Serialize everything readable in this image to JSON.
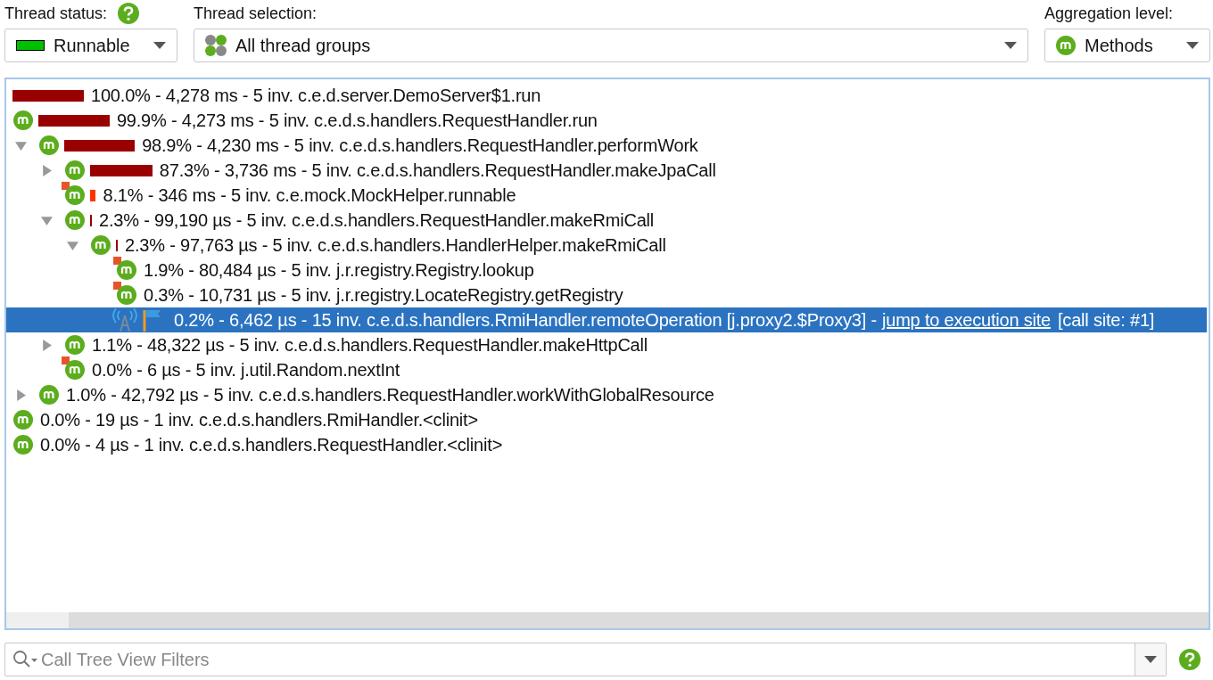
{
  "toolbar": {
    "thread_status": {
      "label": "Thread status:",
      "value": "Runnable"
    },
    "thread_selection": {
      "label": "Thread selection:",
      "value": "All thread groups"
    },
    "aggregation_level": {
      "label": "Aggregation level:",
      "value": "Methods"
    }
  },
  "call_tree": [
    {
      "selected": false,
      "level": 1.0,
      "color": "#990000",
      "text": "100.0% - 4,278 ms - 5 inv. c.e.d.server.DemoServer$1.run",
      "children": [
        {
          "kind": "method",
          "selected": false,
          "level": 0.999,
          "color": "#990000",
          "text": "99.9% - 4,273 ms - 5 inv. c.e.d.s.handlers.RequestHandler.run",
          "children": [
            {
              "kind": "method",
              "selected": false,
              "expanded": true,
              "level": 0.989,
              "color": "#990000",
              "text": "98.9% - 4,230 ms - 5 inv. c.e.d.s.handlers.RequestHandler.performWork",
              "children": [
                {
                  "kind": "method",
                  "selected": false,
                  "expanded": false,
                  "level": 0.873,
                  "color": "#990000",
                  "text": "87.3% - 3,736 ms - 5 inv. c.e.d.s.handlers.RequestHandler.makeJpaCall"
                },
                {
                  "kind": "method-flagged",
                  "selected": false,
                  "level": 0.081,
                  "color": "#ff3300",
                  "text": "8.1% - 346 ms - 5 inv. c.e.mock.MockHelper.runnable"
                },
                {
                  "kind": "method",
                  "selected": false,
                  "expanded": true,
                  "level": 0.023,
                  "color": "#990000",
                  "text": "2.3% - 99,190 µs - 5 inv. c.e.d.s.handlers.RequestHandler.makeRmiCall",
                  "children": [
                    {
                      "kind": "method",
                      "selected": false,
                      "expanded": true,
                      "level": 0.023,
                      "color": "#990000",
                      "text": "2.3% - 97,763 µs - 5 inv. c.e.d.s.handlers.HandlerHelper.makeRmiCall",
                      "children": [
                        {
                          "kind": "method-flagged",
                          "selected": false,
                          "text": "1.9% - 80,484 µs - 5 inv. j.r.registry.Registry.lookup"
                        },
                        {
                          "kind": "method-flagged",
                          "selected": false,
                          "text": "0.3% - 10,731 µs - 5 inv. j.r.registry.LocateRegistry.getRegistry"
                        },
                        {
                          "kind": "rmi",
                          "selected": true,
                          "text": "0.2% - 6,462 µs - 15 inv. c.e.d.s.handlers.RmiHandler.remoteOperation [j.proxy2.$Proxy3] -",
                          "link": "jump to execution site",
                          "call_site": "[call site: #1]"
                        }
                      ]
                    }
                  ]
                },
                {
                  "kind": "method",
                  "selected": false,
                  "expanded": false,
                  "text": "1.1% - 48,322 µs - 5 inv. c.e.d.s.handlers.RequestHandler.makeHttpCall"
                },
                {
                  "kind": "method-flagged",
                  "selected": false,
                  "text": "0.0% - 6 µs - 5 inv. j.util.Random.nextInt"
                }
              ]
            },
            {
              "kind": "method",
              "selected": false,
              "expanded": false,
              "text": "1.0% - 42,792 µs - 5 inv. c.e.d.s.handlers.RequestHandler.workWithGlobalResource"
            }
          ]
        },
        {
          "kind": "method",
          "selected": false,
          "text": "0.0% - 19 µs - 1 inv. c.e.d.s.handlers.RmiHandler.<clinit>"
        },
        {
          "kind": "method",
          "selected": false,
          "text": "0.0% - 4 µs - 1 inv. c.e.d.s.handlers.RequestHandler.<clinit>"
        }
      ]
    }
  ],
  "filter": {
    "placeholder": "Call Tree View Filters"
  }
}
